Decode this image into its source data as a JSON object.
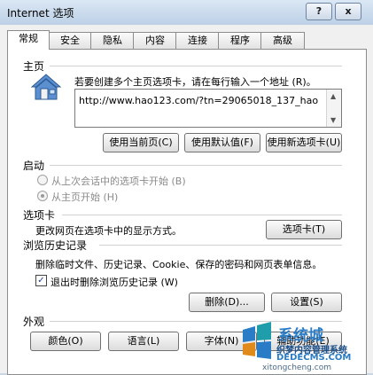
{
  "window": {
    "title": "Internet 选项",
    "help_glyph": "?",
    "close_glyph": "x"
  },
  "tabs": [
    "常规",
    "安全",
    "隐私",
    "内容",
    "连接",
    "程序",
    "高级"
  ],
  "homepage": {
    "section_title": "主页",
    "instruction": "若要创建多个主页选项卡，请在每行输入一个地址 (R)。",
    "url": "http://www.hao123.com/?tn=29065018_137_hao",
    "buttons": [
      "使用当前页(C)",
      "使用默认值(F)",
      "使用新选项卡(U)"
    ]
  },
  "startup": {
    "section_title": "启动",
    "options": [
      "从上次会话中的选项卡开始 (B)",
      "从主页开始 (H)"
    ],
    "selected_index": 1
  },
  "tabs_section": {
    "section_title": "选项卡",
    "description": "更改网页在选项卡中的显示方式。",
    "button": "选项卡(T)"
  },
  "history": {
    "section_title": "浏览历史记录",
    "description": "删除临时文件、历史记录、Cookie、保存的密码和网页表单信息。",
    "checkbox_label": "退出时删除浏览历史记录 (W)",
    "checkbox_checked": true,
    "delete_button": "删除(D)...",
    "settings_button": "设置(S)"
  },
  "appearance": {
    "section_title": "外观",
    "buttons": [
      "颜色(O)",
      "语言(L)",
      "字体(N)",
      "辅助功能(E)"
    ]
  },
  "watermark": {
    "brand_glyph": "系统城",
    "line1": "织梦内容管理系统",
    "line2": "DEDECMS.COM",
    "line3": "xitongcheng.com",
    "colors": {
      "blue": "#2a7cc7",
      "teal": "#1f9dab",
      "orange": "#e08a1c"
    }
  }
}
